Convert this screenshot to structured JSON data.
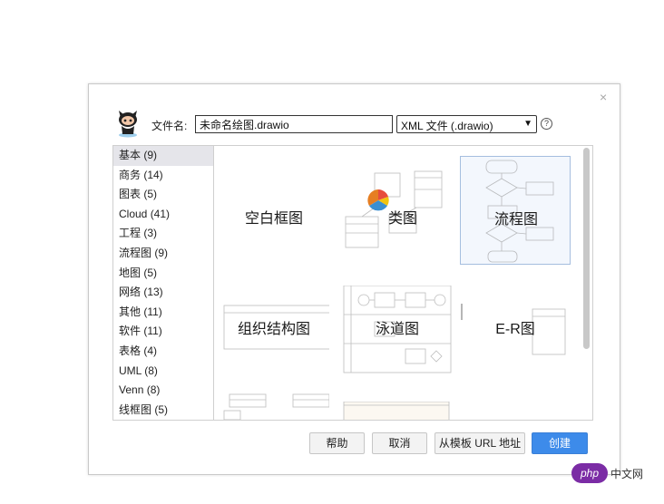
{
  "dialog": {
    "close_glyph": "×",
    "filename_label": "文件名:",
    "filename_value": "未命名绘图.drawio",
    "filetype_value": "XML 文件 (.drawio)",
    "help_glyph": "?"
  },
  "categories": [
    "基本 (9)",
    "商务 (14)",
    "图表 (5)",
    "Cloud (41)",
    "工程 (3)",
    "流程图 (9)",
    "地图 (5)",
    "网络 (13)",
    "其他 (11)",
    "软件 (11)",
    "表格 (4)",
    "UML (8)",
    "Venn (8)",
    "线框图 (5)"
  ],
  "templates": {
    "blank": "空白框图",
    "class": "类图",
    "flowchart": "流程图",
    "orgchart": "组织结构图",
    "swimlane": "泳道图",
    "er": "E-R图"
  },
  "buttons": {
    "help": "帮助",
    "cancel": "取消",
    "from_url": "从模板 URL 地址",
    "create": "创建"
  },
  "watermark": {
    "badge": "php",
    "text": "中文网"
  },
  "colors": {
    "primary": "#3d8bea",
    "selected_category": "#e5e5ea",
    "selected_template_border": "#a5bedf"
  }
}
